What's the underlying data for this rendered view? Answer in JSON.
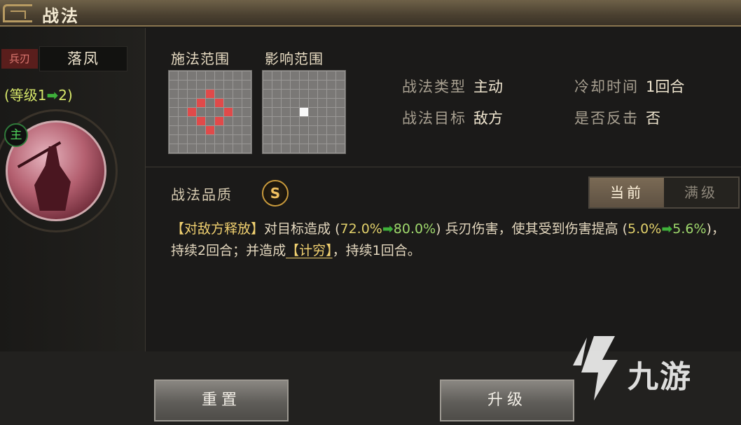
{
  "header": {
    "title": "战法"
  },
  "skill": {
    "weapon_tag": "兵刃",
    "name": "落凤",
    "level_prefix": "(等级1",
    "level_arrow": "➡",
    "level_suffix": "2)",
    "main_badge": "主"
  },
  "ranges": {
    "cast_label": "施法范围",
    "effect_label": "影响范围"
  },
  "attributes": {
    "type_key": "战法类型",
    "type_value": "主动",
    "cooldown_key": "冷却时间",
    "cooldown_value": "1回合",
    "target_key": "战法目标",
    "target_value": "敌方",
    "counter_key": "是否反击",
    "counter_value": "否"
  },
  "quality": {
    "label": "战法品质",
    "grade": "S"
  },
  "tabs": {
    "current": "当前",
    "max": "满级"
  },
  "description": {
    "trigger": "【对敌方释放】",
    "t1": "对目标造成",
    "p1_open": " (",
    "p1_old": "72.0%",
    "arrow": "➡",
    "p1_new": "80.0%",
    "p1_close": ")",
    "t2": " 兵刃伤害，使其受到伤害提高",
    "p2_open": " (",
    "p2_old": "5.0%",
    "p2_new": "5.6%",
    "p2_close": ")",
    "t3": "，持续2回合；并造成",
    "keyword": "【计穷】",
    "t4": "，持续1回合。"
  },
  "buttons": {
    "reset": "重置",
    "upgrade": "升级"
  },
  "watermark": {
    "text": "九游"
  },
  "colors": {
    "accent_gold": "#c99a3c",
    "range_red": "#e04a4a",
    "arrow_green": "#3fb03a"
  }
}
